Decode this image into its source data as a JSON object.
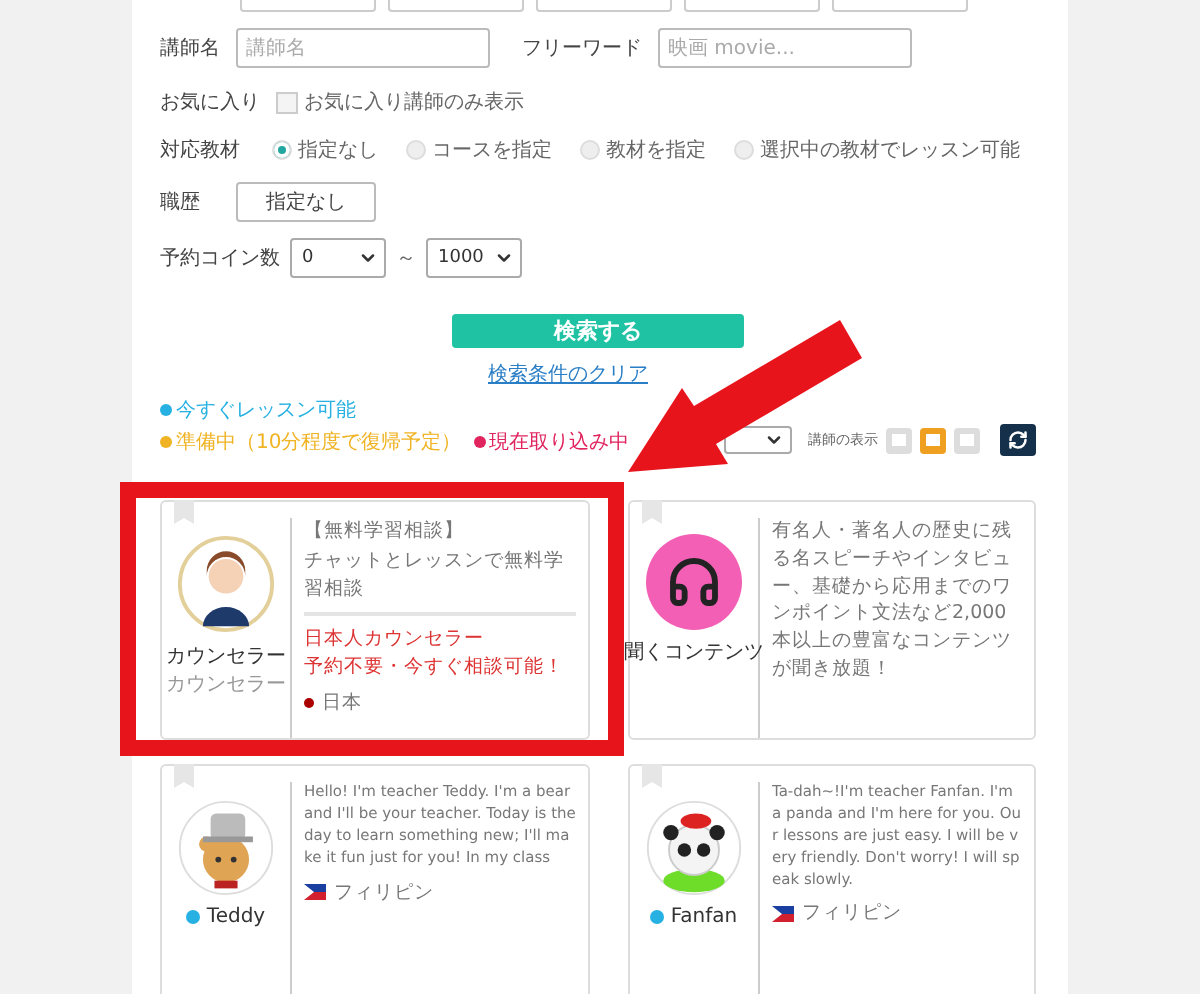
{
  "form": {
    "teacher": {
      "label": "講師名",
      "placeholder": "講師名"
    },
    "freeword": {
      "label": "フリーワード",
      "placeholder": "映画 movie..."
    },
    "favorite": {
      "label": "お気に入り",
      "option": "お気に入り講師のみ表示",
      "checked": false
    },
    "material": {
      "label": "対応教材",
      "options": [
        {
          "label": "指定なし",
          "selected": true
        },
        {
          "label": "コースを指定",
          "selected": false
        },
        {
          "label": "教材を指定",
          "selected": false
        },
        {
          "label": "選択中の教材でレッスン可能",
          "selected": false
        }
      ]
    },
    "career": {
      "label": "職歴",
      "button": "指定なし"
    },
    "coins": {
      "label": "予約コイン数",
      "min": "0",
      "separator": "～",
      "max": "1000"
    },
    "search_button": "検索する",
    "clear_link": "検索条件のクリア"
  },
  "legend": [
    {
      "label": "今すぐレッスン可能",
      "color": "#27b1e2"
    },
    {
      "label": "準備中（10分程度で復帰予定）",
      "color": "#f0b323"
    },
    {
      "label": "現在取り込み中",
      "color": "#e0245e"
    }
  ],
  "view": {
    "label": "講師の表示",
    "options": [
      {
        "selected": false
      },
      {
        "selected": true
      },
      {
        "selected": false
      }
    ]
  },
  "cards": [
    {
      "kind": "counselor",
      "name": "カウンセラー",
      "subtitle": "カウンセラー",
      "description": [
        "【無料学習相談】",
        "チャットとレッスンで無料学習相談"
      ],
      "notes": [
        "日本人カウンセラー",
        "予約不要・今すぐ相談可能！"
      ],
      "country": {
        "name": "日本"
      }
    },
    {
      "kind": "headphones",
      "name": "聞くコンテンツ",
      "description": [
        "有名人・著名人の歴史に残る名スピーチやインタビュー、基礎から応用までのワンポイント文法など2,000本以上の豊富なコンテンツが聞き放題！"
      ]
    },
    {
      "kind": "bear",
      "name": "Teddy",
      "online": true,
      "description": [
        "Hello! I'm teacher Teddy. I'm a bear and I'll be your teacher. Today is the day to learn something new; I'll make it fun just for you! In my class"
      ],
      "country": {
        "name": "フィリピン"
      }
    },
    {
      "kind": "panda",
      "name": "Fanfan",
      "online": true,
      "description": [
        "Ta-dah~!I'm teacher Fanfan. I'm a panda and I'm here for you. Our lessons are just easy. I will be very friendly. Don't worry! I will speak slowly."
      ],
      "country": {
        "name": "フィリピン"
      }
    }
  ],
  "highlight_frame": true,
  "pointer_arrow": true
}
